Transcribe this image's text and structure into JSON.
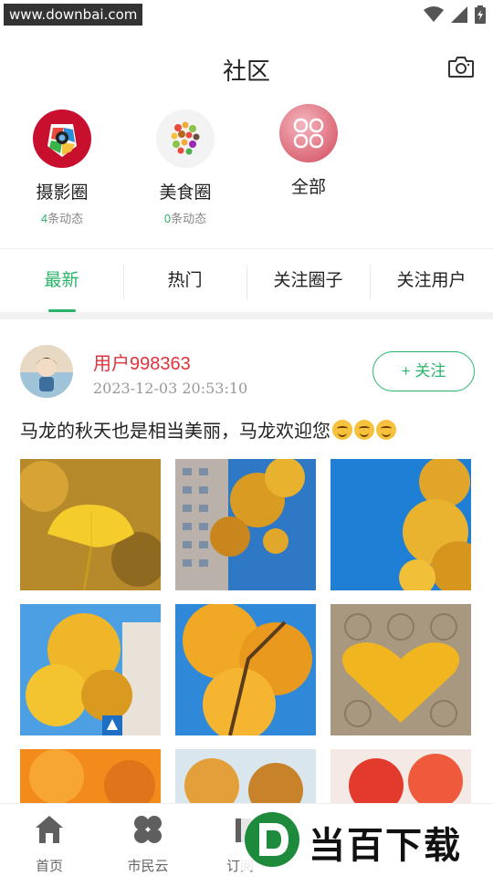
{
  "status_bar": {
    "watermark": "www.downbai.com"
  },
  "header": {
    "title": "社区",
    "camera_icon": "camera-icon"
  },
  "circles": [
    {
      "name": "摄影圈",
      "count": "4",
      "count_suffix": "条动态"
    },
    {
      "name": "美食圈",
      "count": "0",
      "count_suffix": "条动态"
    },
    {
      "name": "全部"
    }
  ],
  "tabs": [
    {
      "label": "最新",
      "active": true
    },
    {
      "label": "热门"
    },
    {
      "label": "关注圈子"
    },
    {
      "label": "关注用户"
    }
  ],
  "post": {
    "username": "用户998363",
    "timestamp": "2023-12-03 20:53:10",
    "follow_label": "+ 关注",
    "text": "马龙的秋天也是相当美丽，马龙欢迎您",
    "emoji_count": 3
  },
  "bottom_nav": [
    {
      "label": "首页",
      "icon": "home-icon"
    },
    {
      "label": "市民云",
      "icon": "clover-icon"
    },
    {
      "label": "订阅",
      "icon": "subscribe-icon"
    },
    {
      "label": "",
      "icon": "community-icon"
    },
    {
      "label": "",
      "icon": "profile-icon"
    }
  ],
  "brand_watermark": {
    "text": "当百下载",
    "letter": "D"
  },
  "colors": {
    "accent": "#2bb36a",
    "username": "#e0323a"
  }
}
